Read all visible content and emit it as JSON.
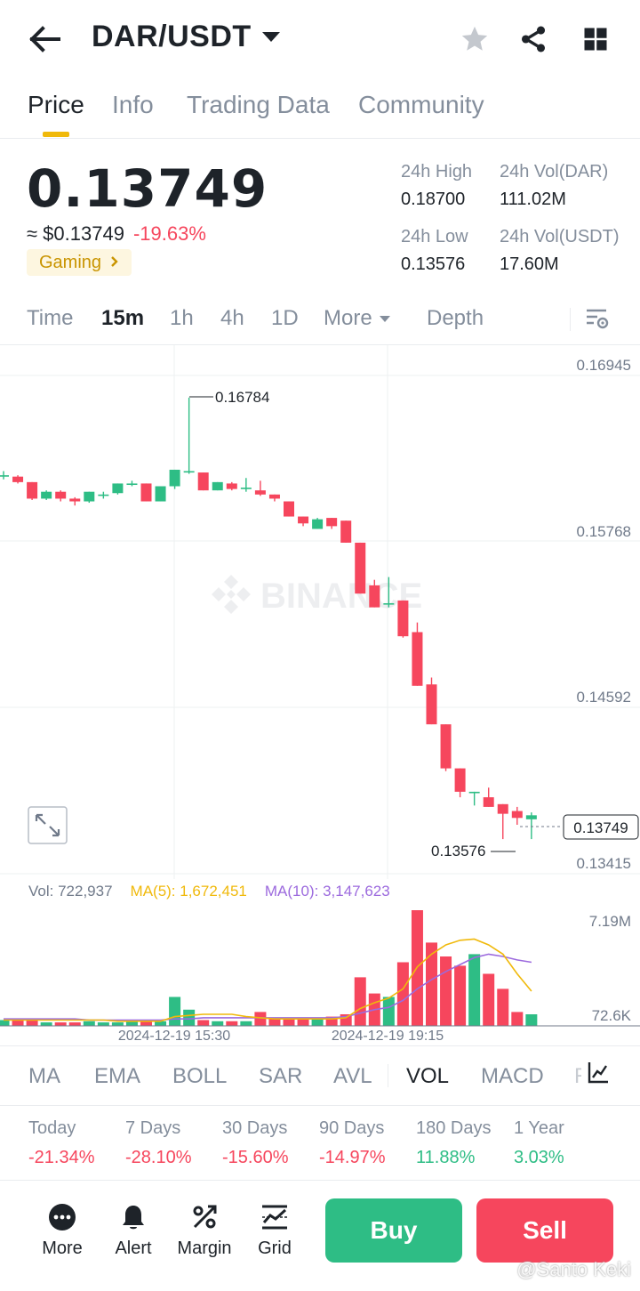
{
  "header": {
    "pair": "DAR/USDT"
  },
  "tabs": [
    "Price",
    "Info",
    "Trading Data",
    "Community"
  ],
  "price": {
    "last": "0.13749",
    "approx": "≈ $0.13749",
    "change": "-19.63%",
    "tag": "Gaming",
    "stats": {
      "high_label": "24h High",
      "high": "0.18700",
      "low_label": "24h Low",
      "low": "0.13576",
      "vol_base_label": "24h Vol(DAR)",
      "vol_base": "111.02M",
      "vol_quote_label": "24h Vol(USDT)",
      "vol_quote": "17.60M"
    }
  },
  "intervals": [
    "Time",
    "15m",
    "1h",
    "4h",
    "1D",
    "More",
    "Depth"
  ],
  "chart": {
    "price_axis": [
      "0.16945",
      "0.15768",
      "0.14592",
      "0.13415"
    ],
    "max_label": "0.16784",
    "min_label": "0.13576",
    "last_label": "0.13749",
    "watermark": "BINANCE",
    "vol_axis": [
      "7.19M",
      "72.6K"
    ],
    "time_labels": [
      "2024-12-19 15:30",
      "2024-12-19 19:15"
    ]
  },
  "volume_legend": {
    "vol": "Vol: 722,937",
    "ma5": "MA(5): 1,672,451",
    "ma10": "MA(10): 3,147,623"
  },
  "indicators": [
    "MA",
    "EMA",
    "BOLL",
    "SAR",
    "AVL",
    "VOL",
    "MACD",
    "R"
  ],
  "performance": [
    {
      "label": "Today",
      "value": "-21.34%"
    },
    {
      "label": "7 Days",
      "value": "-28.10%"
    },
    {
      "label": "30 Days",
      "value": "-15.60%"
    },
    {
      "label": "90 Days",
      "value": "-14.97%"
    },
    {
      "label": "180 Days",
      "value": "11.88%"
    },
    {
      "label": "1 Year",
      "value": "3.03%"
    }
  ],
  "bottom_nav": [
    "More",
    "Alert",
    "Margin",
    "Grid"
  ],
  "actions": {
    "buy": "Buy",
    "sell": "Sell"
  },
  "watermark_credit": "@Santo Keki",
  "colors": {
    "up": "#2ebd85",
    "down": "#f6465d",
    "accent": "#f0b90b",
    "ma5": "#f0b90b",
    "ma10": "#9c6ade"
  },
  "chart_data": {
    "type": "candlestick",
    "interval": "15m",
    "ylim": [
      0.13415,
      0.16945
    ],
    "candles": [
      {
        "o": 0.1622,
        "c": 0.1622,
        "h": 0.1625,
        "l": 0.1619
      },
      {
        "o": 0.1621,
        "c": 0.1617,
        "h": 0.1622,
        "l": 0.1616
      },
      {
        "o": 0.1617,
        "c": 0.1605,
        "h": 0.1617,
        "l": 0.1604
      },
      {
        "o": 0.1605,
        "c": 0.161,
        "h": 0.1611,
        "l": 0.1604
      },
      {
        "o": 0.161,
        "c": 0.1605,
        "h": 0.1611,
        "l": 0.1603
      },
      {
        "o": 0.1605,
        "c": 0.1603,
        "h": 0.1606,
        "l": 0.16
      },
      {
        "o": 0.1603,
        "c": 0.161,
        "h": 0.161,
        "l": 0.1602
      },
      {
        "o": 0.1608,
        "c": 0.1608,
        "h": 0.161,
        "l": 0.1605
      },
      {
        "o": 0.1609,
        "c": 0.1616,
        "h": 0.1616,
        "l": 0.1608
      },
      {
        "o": 0.1616,
        "c": 0.1616,
        "h": 0.1618,
        "l": 0.1614
      },
      {
        "o": 0.1616,
        "c": 0.1603,
        "h": 0.1616,
        "l": 0.1603
      },
      {
        "o": 0.1603,
        "c": 0.1614,
        "h": 0.1614,
        "l": 0.1603
      },
      {
        "o": 0.1614,
        "c": 0.1626,
        "h": 0.1626,
        "l": 0.1612
      },
      {
        "o": 0.1625,
        "c": 0.1625,
        "h": 0.16784,
        "l": 0.1623
      },
      {
        "o": 0.1624,
        "c": 0.1611,
        "h": 0.1624,
        "l": 0.1611
      },
      {
        "o": 0.1611,
        "c": 0.1617,
        "h": 0.1617,
        "l": 0.1611
      },
      {
        "o": 0.1616,
        "c": 0.1612,
        "h": 0.1617,
        "l": 0.1611
      },
      {
        "o": 0.1613,
        "c": 0.1613,
        "h": 0.162,
        "l": 0.161
      },
      {
        "o": 0.1611,
        "c": 0.1608,
        "h": 0.1618,
        "l": 0.1607
      },
      {
        "o": 0.1608,
        "c": 0.1605,
        "h": 0.1608,
        "l": 0.1603
      },
      {
        "o": 0.1603,
        "c": 0.1592,
        "h": 0.1603,
        "l": 0.1592
      },
      {
        "o": 0.1592,
        "c": 0.1587,
        "h": 0.1592,
        "l": 0.1585
      },
      {
        "o": 0.1583,
        "c": 0.159,
        "h": 0.1591,
        "l": 0.1583
      },
      {
        "o": 0.1591,
        "c": 0.1585,
        "h": 0.1591,
        "l": 0.1583
      },
      {
        "o": 0.1589,
        "c": 0.1573,
        "h": 0.1589,
        "l": 0.1573
      },
      {
        "o": 0.1573,
        "c": 0.1536,
        "h": 0.1573,
        "l": 0.1536
      },
      {
        "o": 0.1542,
        "c": 0.1526,
        "h": 0.1546,
        "l": 0.1526
      },
      {
        "o": 0.1528,
        "c": 0.1529,
        "h": 0.1548,
        "l": 0.1526
      },
      {
        "o": 0.1531,
        "c": 0.1505,
        "h": 0.1531,
        "l": 0.1504
      },
      {
        "o": 0.1508,
        "c": 0.1469,
        "h": 0.1515,
        "l": 0.1469
      },
      {
        "o": 0.147,
        "c": 0.1441,
        "h": 0.1475,
        "l": 0.1441
      },
      {
        "o": 0.1441,
        "c": 0.1409,
        "h": 0.1441,
        "l": 0.1407
      },
      {
        "o": 0.1409,
        "c": 0.1392,
        "h": 0.1409,
        "l": 0.1388
      },
      {
        "o": 0.1392,
        "c": 0.1392,
        "h": 0.1392,
        "l": 0.1382
      },
      {
        "o": 0.1388,
        "c": 0.1381,
        "h": 0.1395,
        "l": 0.1381
      },
      {
        "o": 0.1383,
        "c": 0.1376,
        "h": 0.1383,
        "l": 0.13576
      },
      {
        "o": 0.1378,
        "c": 0.1373,
        "h": 0.1381,
        "l": 0.1368
      },
      {
        "o": 0.1372,
        "c": 0.13749,
        "h": 0.1377,
        "l": 0.13576
      }
    ],
    "volumes": [
      0.05,
      0.05,
      0.05,
      0.03,
      0.03,
      0.03,
      0.04,
      0.03,
      0.03,
      0.04,
      0.04,
      0.04,
      0.25,
      0.14,
      0.05,
      0.04,
      0.04,
      0.04,
      0.12,
      0.06,
      0.06,
      0.06,
      0.06,
      0.08,
      0.1,
      0.42,
      0.28,
      0.25,
      0.55,
      1.0,
      0.72,
      0.6,
      0.52,
      0.62,
      0.45,
      0.32,
      0.12,
      0.1
    ],
    "ma5": [
      0.05,
      0.05,
      0.05,
      0.05,
      0.05,
      0.05,
      0.05,
      0.05,
      0.04,
      0.04,
      0.04,
      0.04,
      0.08,
      0.09,
      0.1,
      0.1,
      0.1,
      0.08,
      0.07,
      0.06,
      0.06,
      0.06,
      0.06,
      0.06,
      0.07,
      0.15,
      0.2,
      0.24,
      0.32,
      0.51,
      0.62,
      0.7,
      0.74,
      0.75,
      0.7,
      0.62,
      0.45,
      0.3
    ],
    "ma10": [
      0.06,
      0.06,
      0.06,
      0.06,
      0.06,
      0.06,
      0.05,
      0.05,
      0.05,
      0.05,
      0.05,
      0.05,
      0.06,
      0.06,
      0.07,
      0.07,
      0.07,
      0.07,
      0.07,
      0.07,
      0.07,
      0.07,
      0.07,
      0.07,
      0.08,
      0.11,
      0.14,
      0.16,
      0.22,
      0.32,
      0.4,
      0.47,
      0.53,
      0.59,
      0.62,
      0.6,
      0.57,
      0.55
    ]
  }
}
